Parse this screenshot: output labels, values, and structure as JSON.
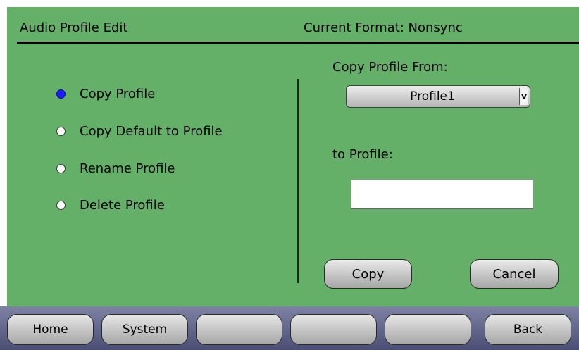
{
  "header": {
    "title": "Audio Profile Edit",
    "format": "Current Format: Nonsync"
  },
  "options": [
    {
      "label": "Copy Profile",
      "selected": true
    },
    {
      "label": "Copy Default to Profile",
      "selected": false
    },
    {
      "label": "Rename Profile",
      "selected": false
    },
    {
      "label": "Delete Profile",
      "selected": false
    }
  ],
  "copy_from": {
    "label": "Copy Profile From:",
    "selected_value": "Profile1",
    "arrow_glyph": "v"
  },
  "to_profile": {
    "label": "to Profile:",
    "value": "",
    "placeholder": ""
  },
  "actions": {
    "copy_label": "Copy",
    "cancel_label": "Cancel"
  },
  "nav": [
    {
      "label": "Home"
    },
    {
      "label": "System"
    },
    {
      "label": ""
    },
    {
      "label": ""
    },
    {
      "label": ""
    },
    {
      "label": "Back"
    }
  ],
  "colors": {
    "panel_bg": "#64b068",
    "radio_selected": "#1c1cff",
    "nav_bar": "#5a5e82"
  }
}
